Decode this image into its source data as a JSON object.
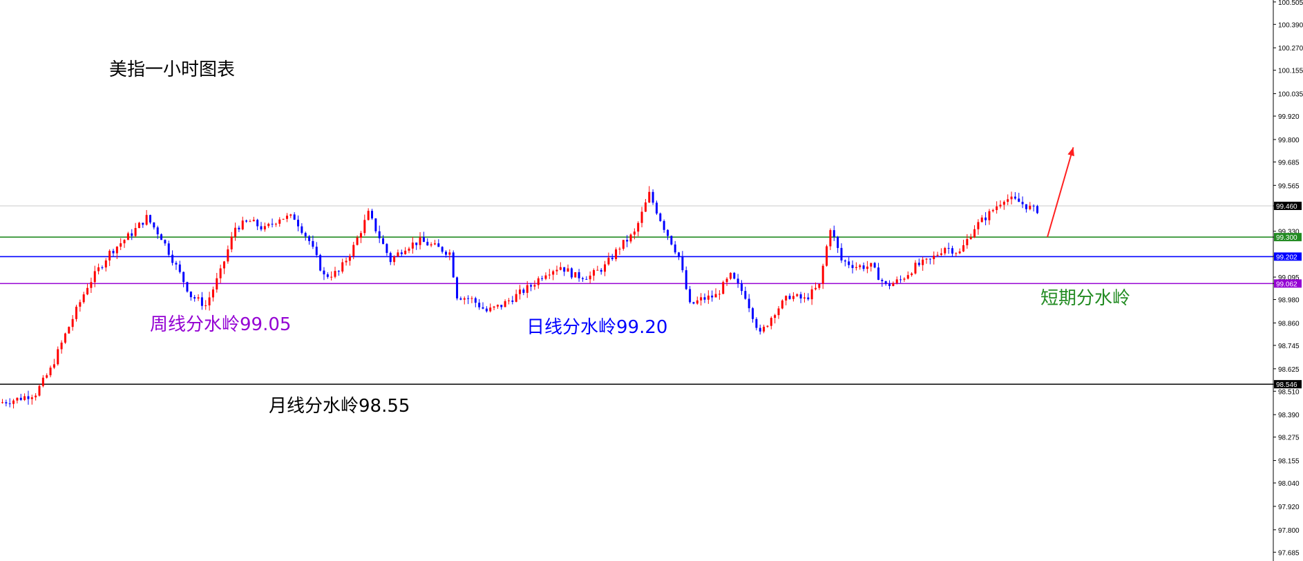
{
  "chart_data": {
    "type": "candlestick",
    "title": "美指一小时图表",
    "ylim": [
      97.64,
      100.515
    ],
    "y_ticks": [
      "100.505",
      "100.390",
      "100.270",
      "100.155",
      "100.035",
      "99.920",
      "99.800",
      "99.685",
      "99.565",
      "99.460",
      "99.330",
      "99.300",
      "99.202",
      "99.095",
      "99.062",
      "98.980",
      "98.860",
      "98.745",
      "98.625",
      "98.546",
      "98.510",
      "98.390",
      "98.275",
      "98.155",
      "98.040",
      "97.920",
      "97.800",
      "97.685"
    ],
    "current_price": {
      "value": 99.46,
      "label": "99.460",
      "color": "#c8c8c8"
    },
    "levels": [
      {
        "name": "short-term",
        "value": 99.3,
        "label": "99.300",
        "color": "#228b22",
        "annotation": "短期分水岭"
      },
      {
        "name": "daily",
        "value": 99.2,
        "label": "99.202",
        "color": "#0000ff",
        "annotation": "日线分水岭99.20"
      },
      {
        "name": "weekly",
        "value": 99.062,
        "label": "99.062",
        "color": "#9400d3",
        "annotation": "周线分水岭99.05"
      },
      {
        "name": "monthly",
        "value": 98.546,
        "label": "98.546",
        "color": "#000000",
        "annotation": "月线分水岭98.55"
      }
    ],
    "anchors": [
      [
        0,
        98.45
      ],
      [
        5,
        98.47
      ],
      [
        10,
        98.5
      ],
      [
        14,
        98.62
      ],
      [
        18,
        98.8
      ],
      [
        24,
        99.05
      ],
      [
        30,
        99.22
      ],
      [
        36,
        99.32
      ],
      [
        40,
        99.4
      ],
      [
        44,
        99.3
      ],
      [
        48,
        99.15
      ],
      [
        52,
        99.0
      ],
      [
        56,
        98.95
      ],
      [
        60,
        99.12
      ],
      [
        64,
        99.35
      ],
      [
        68,
        99.38
      ],
      [
        72,
        99.34
      ],
      [
        76,
        99.4
      ],
      [
        80,
        99.4
      ],
      [
        84,
        99.28
      ],
      [
        88,
        99.1
      ],
      [
        92,
        99.12
      ],
      [
        96,
        99.25
      ],
      [
        100,
        99.42
      ],
      [
        103,
        99.3
      ],
      [
        106,
        99.18
      ],
      [
        110,
        99.25
      ],
      [
        114,
        99.28
      ],
      [
        118,
        99.25
      ],
      [
        122,
        99.22
      ],
      [
        124,
        99.0
      ],
      [
        128,
        98.98
      ],
      [
        132,
        98.92
      ],
      [
        136,
        98.95
      ],
      [
        140,
        99.0
      ],
      [
        144,
        99.05
      ],
      [
        148,
        99.12
      ],
      [
        152,
        99.15
      ],
      [
        156,
        99.1
      ],
      [
        160,
        99.1
      ],
      [
        164,
        99.15
      ],
      [
        168,
        99.25
      ],
      [
        172,
        99.32
      ],
      [
        176,
        99.52
      ],
      [
        180,
        99.35
      ],
      [
        184,
        99.2
      ],
      [
        187,
        98.95
      ],
      [
        190,
        98.98
      ],
      [
        194,
        99.0
      ],
      [
        198,
        99.1
      ],
      [
        202,
        99.0
      ],
      [
        206,
        98.8
      ],
      [
        210,
        98.92
      ],
      [
        214,
        99.0
      ],
      [
        218,
        98.98
      ],
      [
        222,
        99.05
      ],
      [
        225,
        99.35
      ],
      [
        228,
        99.18
      ],
      [
        232,
        99.15
      ],
      [
        236,
        99.15
      ],
      [
        240,
        99.05
      ],
      [
        244,
        99.08
      ],
      [
        248,
        99.15
      ],
      [
        252,
        99.18
      ],
      [
        256,
        99.25
      ],
      [
        260,
        99.22
      ],
      [
        264,
        99.35
      ],
      [
        268,
        99.42
      ],
      [
        272,
        99.5
      ],
      [
        276,
        99.48
      ],
      [
        280,
        99.44
      ]
    ],
    "candle_count": 281,
    "arrow": {
      "from": [
        283,
        99.3
      ],
      "to": [
        290,
        99.76
      ],
      "color": "#ff2020"
    }
  },
  "text": {
    "title": "美指一小时图表",
    "weekly": "周线分水岭99.05",
    "daily": "日线分水岭99.20",
    "monthly": "月线分水岭98.55",
    "short": "短期分水岭"
  }
}
